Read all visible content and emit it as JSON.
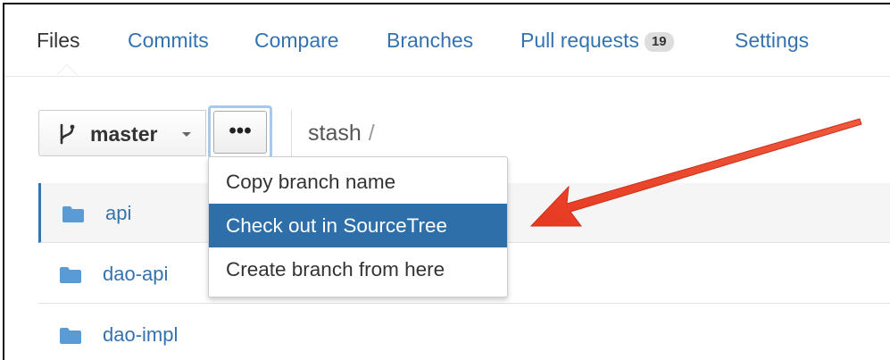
{
  "tabs": [
    {
      "label": "Files",
      "active": true
    },
    {
      "label": "Commits"
    },
    {
      "label": "Compare"
    },
    {
      "label": "Branches"
    },
    {
      "label": "Pull requests",
      "badge": "19"
    },
    {
      "label": "Settings"
    }
  ],
  "toolbar": {
    "branch_label": "master",
    "more_label": "•••",
    "repo": "stash",
    "separator": "/"
  },
  "files": [
    "api",
    "dao-api",
    "dao-impl"
  ],
  "menu": {
    "items": [
      "Copy branch name",
      "Check out in SourceTree",
      "Create branch from here"
    ],
    "highlighted": "Check out in SourceTree"
  },
  "colors": {
    "link": "#3572b0",
    "highlight": "#2e6faa",
    "arrow": "#e8412a"
  },
  "icons": [
    "branch-icon",
    "folder-icon",
    "ellipsis-icon",
    "chevron-down-icon"
  ]
}
